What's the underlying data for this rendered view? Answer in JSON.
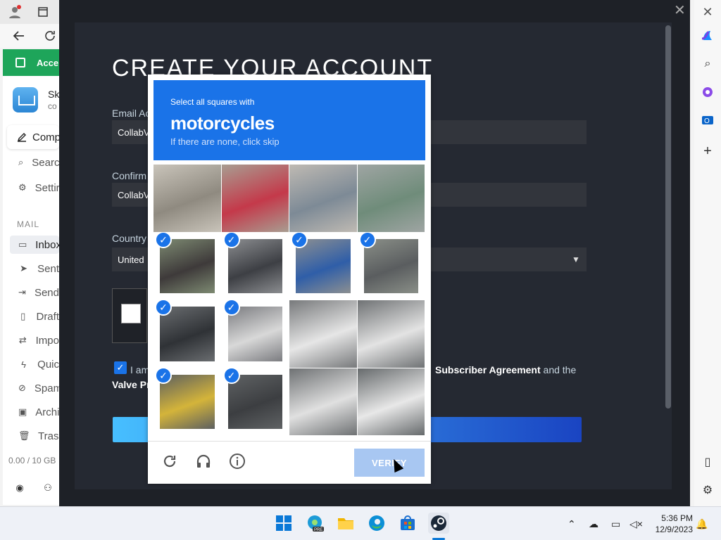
{
  "browser": {
    "account_tab": "Acce",
    "app_name": "Sk",
    "app_sub": "co",
    "compose_label": "Comp",
    "search_label": "Searc",
    "settings_label": "Settir",
    "mail_section": "MAIL",
    "items": [
      {
        "label": "Inbox",
        "icon": "inbox-icon"
      },
      {
        "label": "Sent",
        "icon": "sent-icon"
      },
      {
        "label": "Send",
        "icon": "send-later-icon"
      },
      {
        "label": "Draft",
        "icon": "draft-icon"
      },
      {
        "label": "Impo",
        "icon": "important-icon"
      },
      {
        "label": "Quic",
        "icon": "quick-icon"
      },
      {
        "label": "Spam",
        "icon": "spam-icon"
      },
      {
        "label": "Archi",
        "icon": "archive-icon"
      },
      {
        "label": "Trash",
        "icon": "trash-icon"
      }
    ],
    "storage": "0.00 / 10 GB"
  },
  "form": {
    "heading": "CREATE YOUR ACCOUNT",
    "email_label": "Email Ac",
    "email_value": "CollabV",
    "confirm_label": "Confirm",
    "confirm_value": "CollabV",
    "country_label": "Country",
    "country_value": "United",
    "agree_a": "I am",
    "agree_b_bold": "Subscriber Agreement",
    "agree_b_rest": " and the",
    "agree_c": "Valve Pr"
  },
  "captcha": {
    "instruction": "Select all squares with",
    "target": "motorcycles",
    "hint": "If there are none, click skip",
    "verify_label": "VERIFY",
    "tiles_selected": [
      false,
      false,
      false,
      false,
      true,
      true,
      true,
      true,
      true,
      true,
      false,
      false,
      true,
      true,
      false,
      false
    ]
  },
  "taskbar": {
    "time": "5:36 PM",
    "date": "12/9/2023"
  }
}
